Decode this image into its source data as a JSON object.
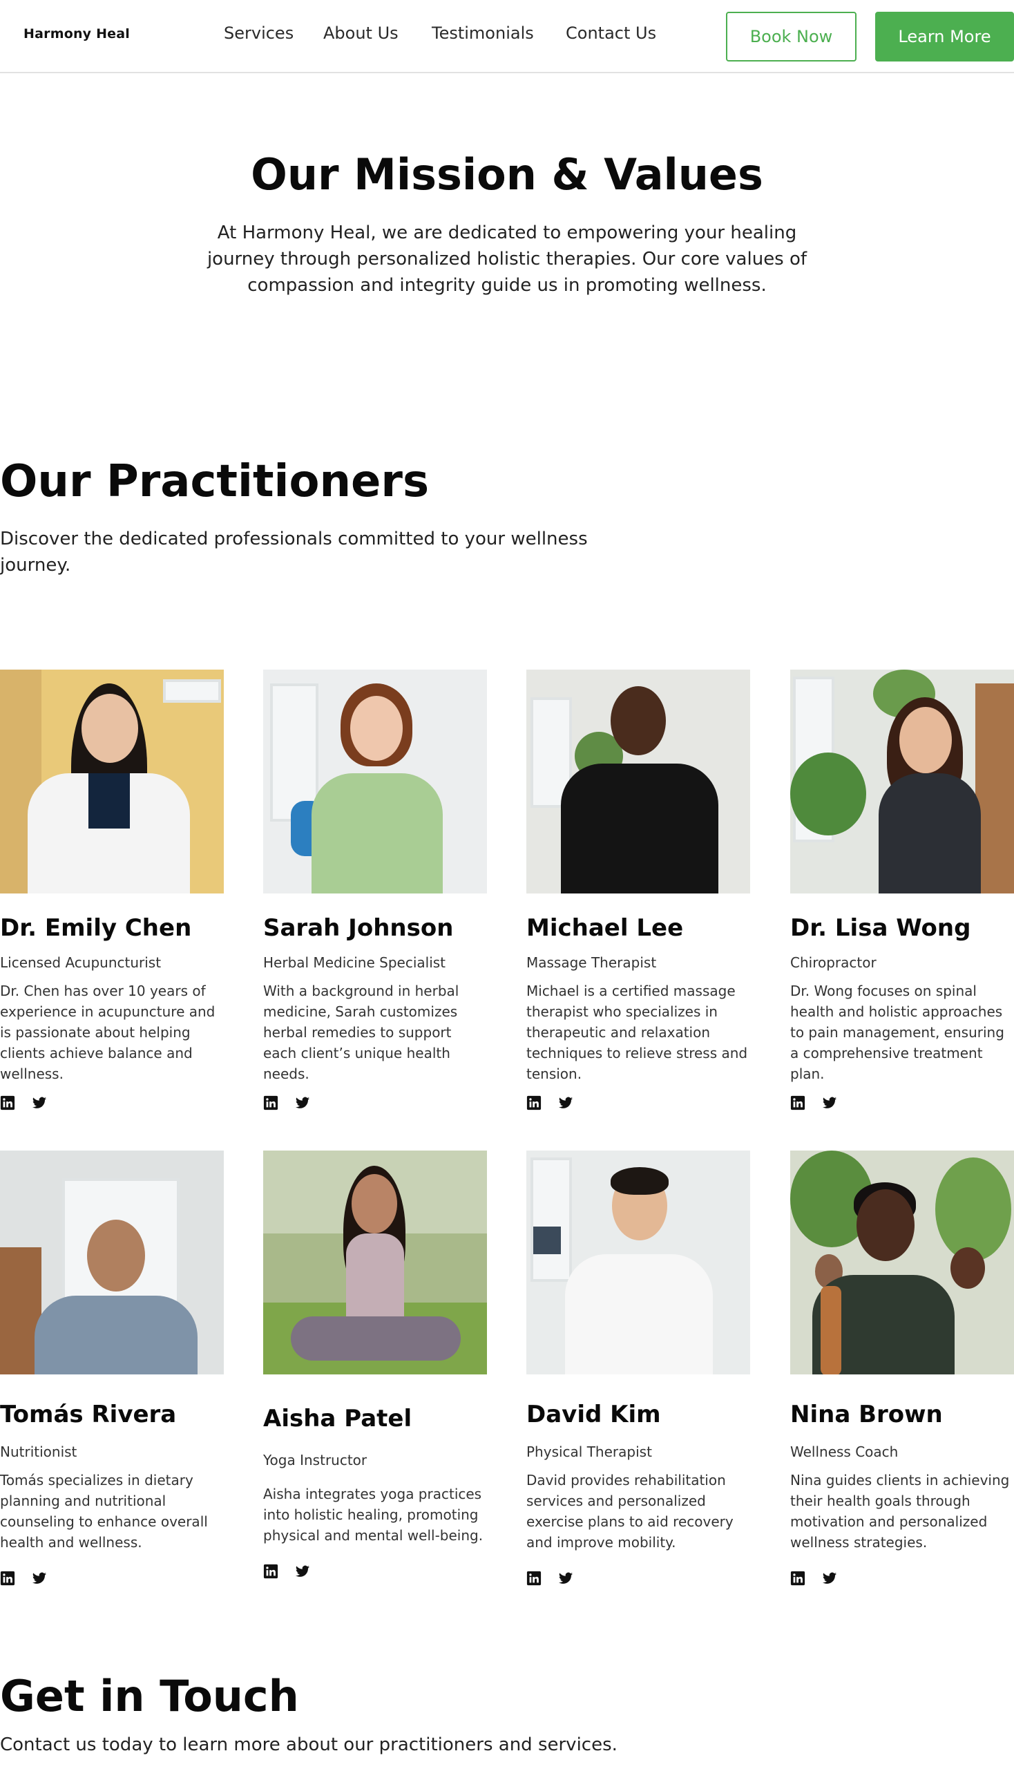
{
  "header": {
    "logo": "Harmony Heal",
    "nav": [
      "Services",
      "About Us",
      "Testimonials",
      "Contact Us"
    ],
    "book_label": "Book Now",
    "learn_label": "Learn More",
    "accent": "#4caf50"
  },
  "mission": {
    "title": "Our Mission & Values",
    "text": "At Harmony Heal, we are dedicated to empowering your healing journey through personalized holistic therapies. Our core values of compassion and integrity guide us in promoting wellness."
  },
  "practitioners": {
    "title": "Our Practitioners",
    "subtitle": "Discover the dedicated professionals committed to your wellness journey.",
    "people": [
      {
        "name": "Dr. Emily Chen",
        "role": "Licensed Acupuncturist",
        "bio": "Dr. Chen has over 10 years of experience in acupuncture and is passionate about helping clients achieve balance and wellness."
      },
      {
        "name": "Sarah Johnson",
        "role": "Herbal Medicine Specialist",
        "bio": "With a background in herbal medicine, Sarah customizes herbal remedies to support each client’s unique health needs."
      },
      {
        "name": "Michael Lee",
        "role": "Massage Therapist",
        "bio": "Michael is a certified massage therapist who specializes in therapeutic and relaxation techniques to relieve stress and tension."
      },
      {
        "name": "Dr. Lisa Wong",
        "role": "Chiropractor",
        "bio": "Dr. Wong focuses on spinal health and holistic approaches to pain management, ensuring a comprehensive treatment plan."
      },
      {
        "name": "Tomás Rivera",
        "role": "Nutritionist",
        "bio": "Tomás specializes in dietary planning and nutritional counseling to enhance overall health and wellness."
      },
      {
        "name": "Aisha Patel",
        "role": "Yoga Instructor",
        "bio": "Aisha integrates yoga practices into holistic healing, promoting physical and mental well-being."
      },
      {
        "name": "David Kim",
        "role": "Physical Therapist",
        "bio": "David provides rehabilitation services and personalized exercise plans to aid recovery and improve mobility."
      },
      {
        "name": "Nina Brown",
        "role": "Wellness Coach",
        "bio": "Nina guides clients in achieving their health goals through motivation and personalized wellness strategies."
      }
    ],
    "social_icons": [
      "linkedin-icon",
      "twitter-icon"
    ]
  },
  "contact": {
    "title": "Get in Touch",
    "text": "Contact us today to learn more about our practitioners and services."
  }
}
